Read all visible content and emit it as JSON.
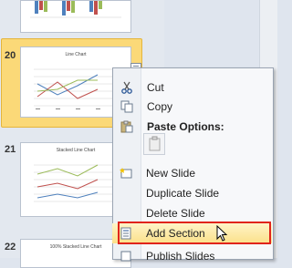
{
  "slides": [
    {
      "number": "20",
      "title": "Line Chart"
    },
    {
      "number": "21",
      "title": "Stacked  Line Chart"
    },
    {
      "number": "22",
      "title": "100% Stacked  Line Chart"
    }
  ],
  "menu": {
    "cut": "Cut",
    "copy": "Copy",
    "paste_options": "Paste Options:",
    "new_slide": "New Slide",
    "duplicate_slide": "Duplicate Slide",
    "delete_slide": "Delete Slide",
    "add_section": "Add Section",
    "publish_slides": "Publish Slides"
  },
  "colors": {
    "highlight_border": "#e0241b",
    "selected_slide": "#fbd978"
  }
}
